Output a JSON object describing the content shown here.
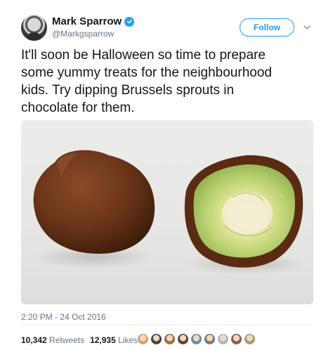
{
  "author": {
    "display_name": "Mark Sparrow",
    "handle": "@Markgsparrow",
    "verified": true,
    "avatar_icon": "profile-photo"
  },
  "follow_label": "Follow",
  "menu_icon": "chevron-down-icon",
  "tweet_text_lines": [
    "It'll soon be Halloween so time to prepare",
    "some yummy treats for the neighbourhood",
    "kids. Try dipping Brussels sprouts in",
    "chocolate for them."
  ],
  "media": {
    "description_visible": false,
    "items": [
      "chocolate-coated-sprout-whole",
      "chocolate-coated-sprout-halved"
    ]
  },
  "timestamp": "2:20 PM - 24 Oct 2016",
  "stats": {
    "retweets_count": "10,342",
    "retweets_label": "Retweets",
    "likes_count": "12,935",
    "likes_label": "Likes"
  },
  "likers_avatars": [
    "#d9a066",
    "#444444",
    "#a0703c",
    "#5a4632",
    "#6b8cae",
    "#7a7a7a",
    "#b0b8c0",
    "#8c5a5a",
    "#9aa07a"
  ],
  "colors": {
    "accent": "#1da1f2",
    "secondary_text": "#657786",
    "primary_text": "#14171a"
  }
}
